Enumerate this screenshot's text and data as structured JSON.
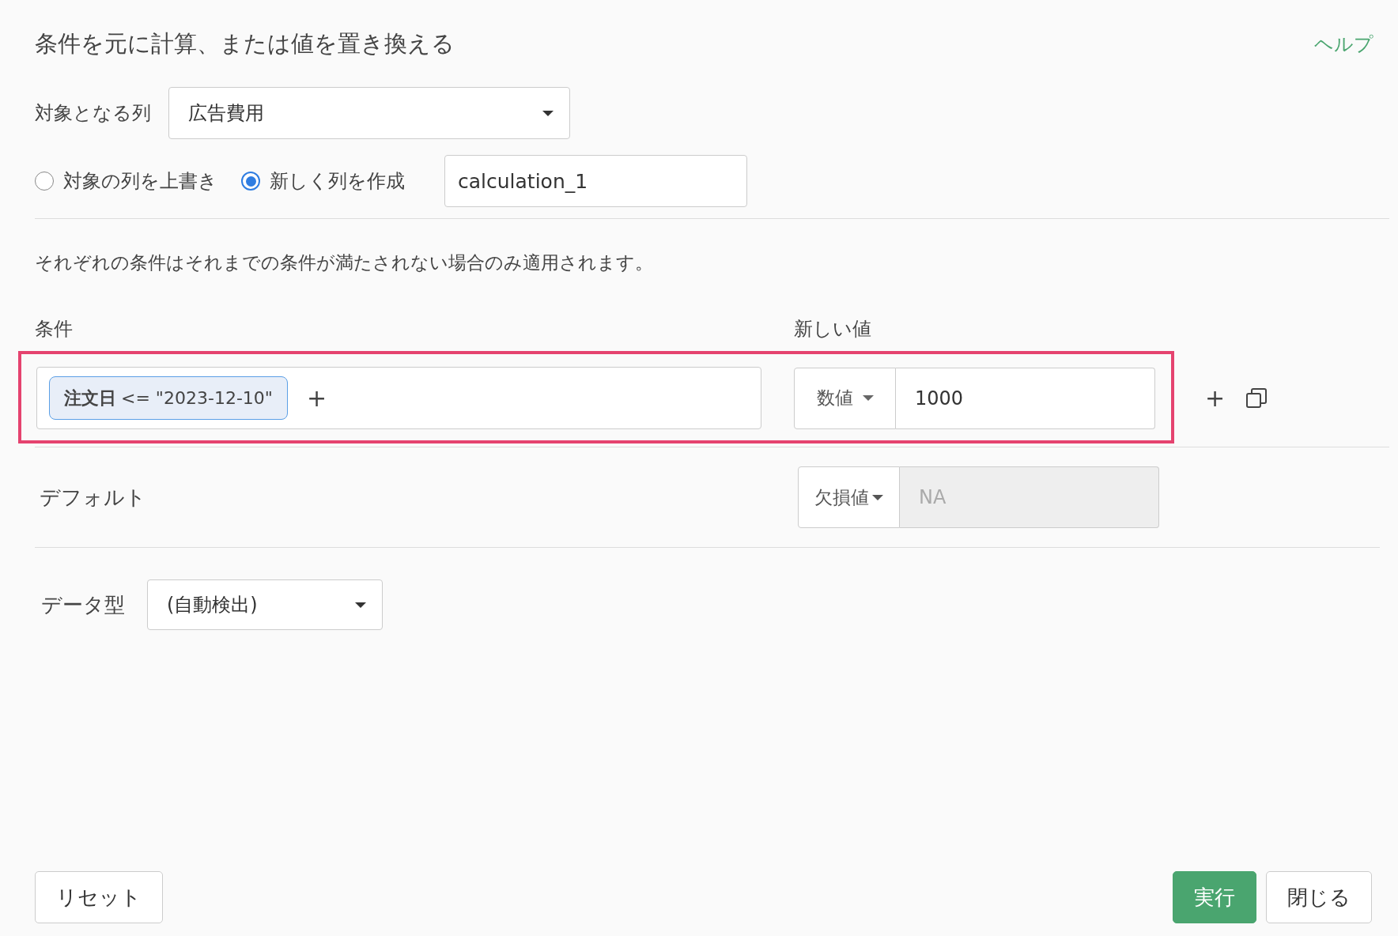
{
  "title": "条件を元に計算、または値を置き換える",
  "help_link": "ヘルプ",
  "target_column": {
    "label": "対象となる列",
    "value": "広告費用"
  },
  "output_mode": [
    {
      "label": "対象の列を上書き",
      "selected": false
    },
    {
      "label": "新しく列を作成",
      "selected": true
    }
  ],
  "new_column_name": "calculation_1",
  "description": "それぞれの条件はそれまでの条件が満たされない場合のみ適用されます。",
  "conditions": {
    "condition_header": "条件",
    "value_header": "新しい値",
    "rows": [
      {
        "highlighted": true,
        "chips": [
          "**注文日** <= \"2023-12-10\""
        ],
        "add_condition": "+",
        "value_type": "数値",
        "value": "1000",
        "add_row": "+"
      }
    ]
  },
  "default": {
    "label": "デフォルト",
    "value_type": "欠損値",
    "value": "NA",
    "disabled": true
  },
  "data_type": {
    "label": "データ型",
    "value": "(自動検出)"
  },
  "buttons": [
    {
      "kind": "secondary",
      "label": "リセット"
    },
    {
      "kind": "primary",
      "label": "実行"
    },
    {
      "kind": "secondary",
      "label": "閉じる"
    }
  ]
}
